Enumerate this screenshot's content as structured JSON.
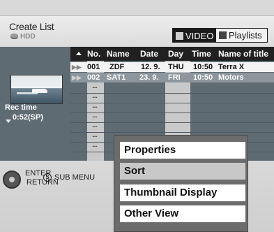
{
  "header": {
    "title": "Create List",
    "drive": "HDD",
    "tabs": [
      {
        "label": "VIDEO",
        "active": true
      },
      {
        "label": "Playlists",
        "active": false
      }
    ]
  },
  "left_panel": {
    "rec_time_label": "Rec time",
    "rec_time_value": "0:52(SP)"
  },
  "table": {
    "columns": [
      "No.",
      "Name",
      "Date",
      "Day",
      "Time",
      "Name of title"
    ],
    "rows": [
      {
        "no": "001",
        "name": "ZDF",
        "date": "12. 9.",
        "day": "THU",
        "time": "10:50",
        "title": "Terra X"
      },
      {
        "no": "002",
        "name": "SAT1",
        "date": "23. 9.",
        "day": "FRI",
        "time": "10:50",
        "title": "Motors"
      }
    ],
    "empty_placeholder": "--"
  },
  "bottom": {
    "enter_label": "ENTER",
    "return_label": "RETURN",
    "submenu_key": "S",
    "submenu_label": "SUB MENU"
  },
  "menu": {
    "items": [
      "Properties",
      "Sort",
      "Thumbnail Display",
      "Other View"
    ],
    "selected": "Sort"
  },
  "colors": {
    "panel": "#5f6b73",
    "header_row": "#202020",
    "selected_row": "#8c969c",
    "highlight_column": "#c6c6c6"
  }
}
